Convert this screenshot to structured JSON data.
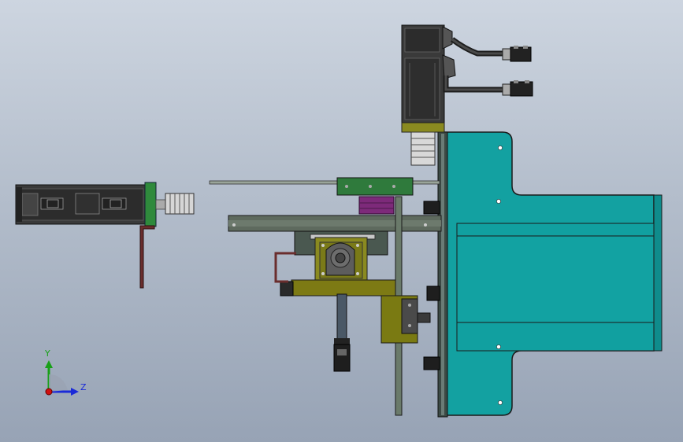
{
  "viewport": {
    "title": "",
    "background_top": "#cdd5e0",
    "background_bottom": "#97a3b5"
  },
  "triad": {
    "y_label": "Y",
    "z_label": "Z",
    "y_color": "#18a018",
    "z_color": "#1a2ad8",
    "origin_color": "#d01010"
  },
  "model": {
    "plate_color": "#13a1a1",
    "motor_color": "#3a3a3a",
    "bracket_color": "#7d7a14",
    "block_color": "#2f7a3c",
    "purple_block_color": "#7d2a7a",
    "rail_color": "#5e6a5e"
  }
}
